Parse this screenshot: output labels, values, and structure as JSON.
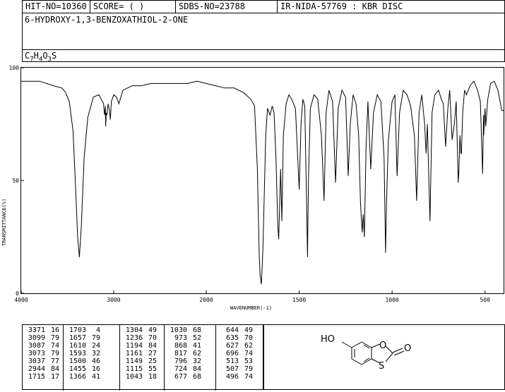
{
  "header": {
    "hit_no": "HIT-NO=10360",
    "score": "SCORE=  (   )",
    "sdbs_no": "SDBS-NO=23788",
    "method": "IR-NIDA-57769 : KBR DISC",
    "compound_name": "6-HYDROXY-1,3-BENZOXATHIOL-2-ONE",
    "formula_parts": [
      "C",
      "7",
      "H",
      "4",
      "O",
      "3",
      "S"
    ]
  },
  "chart_data": {
    "type": "line",
    "xlabel": "WAVENUMBER(-1)",
    "ylabel": "TRANSMITTANCE(%)",
    "xlim": [
      4000,
      400
    ],
    "ylim": [
      0,
      100
    ],
    "x_ticks": [
      "4000",
      "3000",
      "2000",
      "1500",
      "1000",
      "500"
    ],
    "x_tick_values": [
      4000,
      3000,
      2000,
      1500,
      1000,
      500
    ],
    "y_ticks": [
      "0",
      "50",
      "100"
    ],
    "y_tick_values": [
      0,
      50,
      100
    ],
    "series": [
      {
        "x": [
          4000,
          3800,
          3650,
          3560,
          3520,
          3480,
          3440,
          3410,
          3390,
          3371,
          3350,
          3320,
          3280,
          3220,
          3160,
          3110,
          3099,
          3090,
          3087,
          3080,
          3073,
          3060,
          3045,
          3037,
          3025,
          3000,
          2970,
          2944,
          2900,
          2800,
          2700,
          2600,
          2500,
          2400,
          2300,
          2200,
          2100,
          2000,
          1950,
          1900,
          1850,
          1800,
          1760,
          1740,
          1725,
          1715,
          1710,
          1703,
          1695,
          1680,
          1670,
          1657,
          1645,
          1635,
          1625,
          1615,
          1610,
          1600,
          1593,
          1585,
          1570,
          1555,
          1540,
          1520,
          1500,
          1490,
          1480,
          1470,
          1460,
          1455,
          1450,
          1440,
          1420,
          1400,
          1380,
          1366,
          1355,
          1340,
          1320,
          1304,
          1290,
          1270,
          1250,
          1236,
          1225,
          1210,
          1194,
          1180,
          1170,
          1161,
          1155,
          1149,
          1140,
          1130,
          1115,
          1100,
          1080,
          1060,
          1043,
          1035,
          1030,
          1020,
          1000,
          985,
          973,
          960,
          940,
          920,
          900,
          880,
          868,
          855,
          840,
          825,
          817,
          810,
          796,
          785,
          770,
          750,
          735,
          724,
          712,
          700,
          690,
          677,
          665,
          655,
          644,
          640,
          635,
          630,
          627,
          620,
          610,
          600,
          580,
          560,
          540,
          525,
          513,
          508,
          507,
          500,
          496,
          485,
          470,
          450,
          430,
          410,
          400
        ],
        "y": [
          94,
          94,
          92,
          91,
          89,
          85,
          72,
          45,
          25,
          16,
          30,
          60,
          78,
          87,
          88,
          84,
          79,
          83,
          74,
          80,
          79,
          84,
          81,
          77,
          85,
          88,
          87,
          84,
          90,
          92,
          92,
          93,
          93,
          93,
          93,
          93,
          94,
          93,
          92,
          91,
          91,
          89,
          86,
          83,
          55,
          17,
          8,
          4,
          20,
          70,
          82,
          79,
          83,
          80,
          60,
          30,
          24,
          55,
          32,
          70,
          84,
          88,
          86,
          82,
          46,
          75,
          86,
          83,
          40,
          16,
          50,
          82,
          88,
          86,
          70,
          41,
          80,
          90,
          85,
          49,
          82,
          90,
          87,
          52,
          75,
          88,
          84,
          70,
          40,
          27,
          35,
          25,
          65,
          85,
          55,
          80,
          88,
          85,
          60,
          18,
          40,
          68,
          85,
          88,
          52,
          80,
          90,
          88,
          83,
          70,
          41,
          80,
          88,
          75,
          62,
          75,
          32,
          80,
          88,
          90,
          86,
          84,
          65,
          82,
          90,
          68,
          75,
          85,
          49,
          55,
          70,
          62,
          62,
          80,
          90,
          88,
          92,
          94,
          90,
          85,
          53,
          79,
          70,
          82,
          74,
          86,
          93,
          94,
          90,
          81,
          81
        ]
      }
    ],
    "peaks": [
      {
        "wavenumber": 3371,
        "t": 16
      },
      {
        "wavenumber": 3099,
        "t": 79
      },
      {
        "wavenumber": 3087,
        "t": 74
      },
      {
        "wavenumber": 3073,
        "t": 79
      },
      {
        "wavenumber": 3037,
        "t": 77
      },
      {
        "wavenumber": 2944,
        "t": 84
      },
      {
        "wavenumber": 1715,
        "t": 17
      },
      {
        "wavenumber": 1703,
        "t": 4
      },
      {
        "wavenumber": 1657,
        "t": 79
      },
      {
        "wavenumber": 1610,
        "t": 24
      },
      {
        "wavenumber": 1593,
        "t": 32
      },
      {
        "wavenumber": 1500,
        "t": 46
      },
      {
        "wavenumber": 1455,
        "t": 16
      },
      {
        "wavenumber": 1366,
        "t": 41
      },
      {
        "wavenumber": 1304,
        "t": 49
      },
      {
        "wavenumber": 1236,
        "t": 70
      },
      {
        "wavenumber": 1194,
        "t": 84
      },
      {
        "wavenumber": 1161,
        "t": 27
      },
      {
        "wavenumber": 1149,
        "t": 25
      },
      {
        "wavenumber": 1115,
        "t": 55
      },
      {
        "wavenumber": 1043,
        "t": 18
      },
      {
        "wavenumber": 1030,
        "t": 68
      },
      {
        "wavenumber": 973,
        "t": 52
      },
      {
        "wavenumber": 868,
        "t": 41
      },
      {
        "wavenumber": 817,
        "t": 62
      },
      {
        "wavenumber": 796,
        "t": 32
      },
      {
        "wavenumber": 724,
        "t": 84
      },
      {
        "wavenumber": 677,
        "t": 68
      },
      {
        "wavenumber": 644,
        "t": 49
      },
      {
        "wavenumber": 635,
        "t": 70
      },
      {
        "wavenumber": 627,
        "t": 62
      },
      {
        "wavenumber": 696,
        "t": 74
      },
      {
        "wavenumber": 513,
        "t": 53
      },
      {
        "wavenumber": 507,
        "t": 79
      },
      {
        "wavenumber": 496,
        "t": 74
      }
    ],
    "grid": false
  },
  "peak_table": {
    "columns": [
      [
        [
          "3371",
          "16"
        ],
        [
          "3099",
          "79"
        ],
        [
          "3087",
          "74"
        ],
        [
          "3073",
          "79"
        ],
        [
          "3037",
          "77"
        ],
        [
          "2944",
          "84"
        ],
        [
          "1715",
          "17"
        ]
      ],
      [
        [
          "1703",
          "4"
        ],
        [
          "1657",
          "79"
        ],
        [
          "1610",
          "24"
        ],
        [
          "1593",
          "32"
        ],
        [
          "1500",
          "46"
        ],
        [
          "1455",
          "16"
        ],
        [
          "1366",
          "41"
        ]
      ],
      [
        [
          "1304",
          "49"
        ],
        [
          "1236",
          "70"
        ],
        [
          "1194",
          "84"
        ],
        [
          "1161",
          "27"
        ],
        [
          "1149",
          "25"
        ],
        [
          "1115",
          "55"
        ],
        [
          "1043",
          "18"
        ]
      ],
      [
        [
          "1030",
          "68"
        ],
        [
          "973",
          "52"
        ],
        [
          "868",
          "41"
        ],
        [
          "817",
          "62"
        ],
        [
          "796",
          "32"
        ],
        [
          "724",
          "84"
        ],
        [
          "677",
          "68"
        ]
      ],
      [
        [
          "644",
          "49"
        ],
        [
          "635",
          "70"
        ],
        [
          "627",
          "62"
        ],
        [
          "696",
          "74"
        ],
        [
          "513",
          "53"
        ],
        [
          "507",
          "79"
        ],
        [
          "496",
          "74"
        ]
      ]
    ]
  },
  "structure": {
    "labels": [
      "HO",
      "O",
      "O",
      "S"
    ]
  }
}
